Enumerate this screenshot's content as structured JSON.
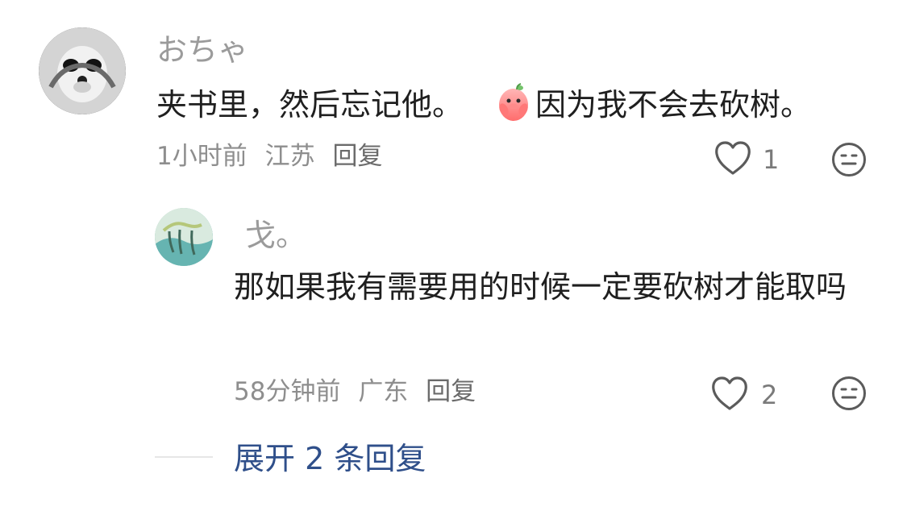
{
  "comments": {
    "main": {
      "username": "おちゃ",
      "text_before_emoji": "夹书里，然后忘记他。",
      "emoji": "pig-emoji",
      "text_after_emoji": "因为我不会去砍树。",
      "time": "1小时前",
      "location": "江苏",
      "reply_label": "回复",
      "like_count": "1",
      "like_icon": "heart-icon",
      "react_icon": "face-icon"
    },
    "reply": {
      "username": "戈。",
      "text": "那如果我有需要用的时候一定要砍树才能取吗",
      "time": "58分钟前",
      "location": "广东",
      "reply_label": "回复",
      "like_count": "2",
      "like_icon": "heart-icon",
      "react_icon": "face-icon"
    },
    "expand_label": "展开 2 条回复"
  },
  "colors": {
    "username": "#9b9b9b",
    "meta": "#8e8e8e",
    "link": "#2f4f8a",
    "text": "#1f1f1f",
    "icon": "#5b5b5b"
  }
}
